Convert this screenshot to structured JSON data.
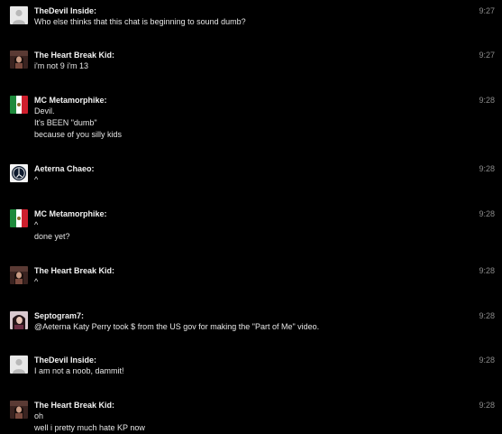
{
  "messages": [
    {
      "author": "TheDevil Inside:",
      "time": "9:27",
      "avatar": "default-user-icon",
      "lines": [
        "Who else thinks that this chat is beginning to sound dumb?"
      ]
    },
    {
      "author": "The Heart Break Kid:",
      "time": "9:27",
      "avatar": "heartbreak-kid-photo-icon",
      "lines": [
        "i'm not 9 i'm 13"
      ]
    },
    {
      "author": "MC Metamorphike:",
      "time": "9:28",
      "avatar": "mexico-flag-icon",
      "lines": [
        "Devil.",
        "It's BEEN \"dumb\"",
        "because of you silly kids"
      ]
    },
    {
      "author": "Aeterna Chaeo:",
      "time": "9:28",
      "avatar": "aeterna-logo-icon",
      "lines": [
        "^"
      ]
    },
    {
      "author": "MC Metamorphike:",
      "time": "9:28",
      "avatar": "mexico-flag-icon",
      "lines": [
        "^",
        "done yet?"
      ]
    },
    {
      "author": "The Heart Break Kid:",
      "time": "9:28",
      "avatar": "heartbreak-kid-photo-icon",
      "lines": [
        "^"
      ]
    },
    {
      "author": "Septogram7:",
      "time": "9:28",
      "avatar": "septogram-photo-icon",
      "lines": [
        "@Aeterna Katy Perry took $ from the US gov for making the \"Part of Me\" video."
      ]
    },
    {
      "author": "TheDevil Inside:",
      "time": "9:28",
      "avatar": "default-user-icon",
      "lines": [
        "I am not a noob, dammit!"
      ]
    },
    {
      "author": "The Heart Break Kid:",
      "time": "9:28",
      "avatar": "heartbreak-kid-photo-icon",
      "lines": [
        "oh",
        "well i pretty much hate KP now"
      ]
    }
  ],
  "colors": {
    "background": "#000000",
    "author_text": "#f2f2f2",
    "message_text": "#e6e6e6",
    "timestamp_text": "#8a8a8a"
  }
}
